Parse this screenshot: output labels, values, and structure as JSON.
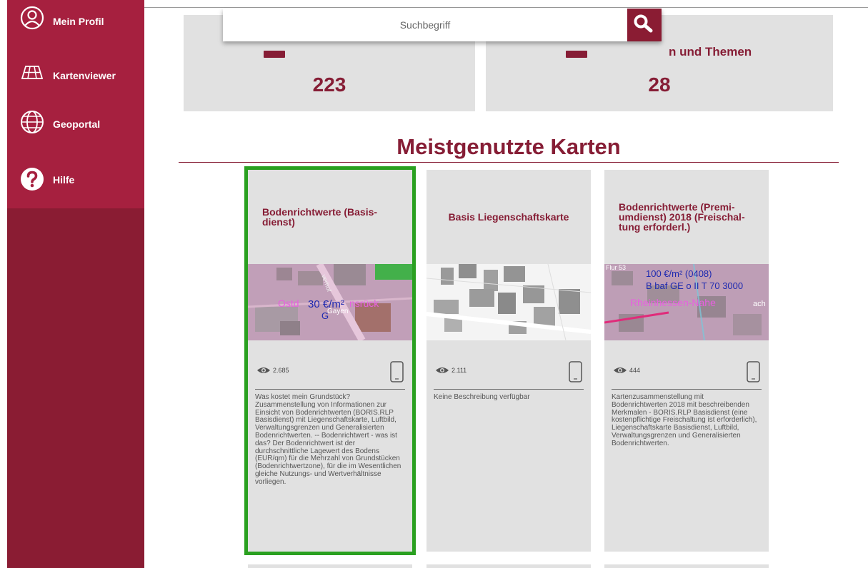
{
  "sidebar": {
    "items": [
      {
        "label": "Mein Profil",
        "icon": "user-circle-icon"
      },
      {
        "label": "Kartenviewer",
        "icon": "map-grid-icon"
      },
      {
        "label": "Geoportal",
        "icon": "globe-icon"
      },
      {
        "label": "Hilfe",
        "icon": "help-icon"
      }
    ]
  },
  "stats": [
    {
      "title": "",
      "value": "223"
    },
    {
      "title": "n und Themen",
      "value": "28"
    }
  ],
  "search": {
    "placeholder": "Suchbegriff",
    "button_icon": "search-icon"
  },
  "section": {
    "title": "Meistgenutzte Karten"
  },
  "cards": [
    {
      "title": "Bodenrichtwerte (Basis-dienst)",
      "views": "2.685",
      "description": "Was kostet mein Grundstück? Zusammenstellung von Informationen zur Einsicht von Bodenrichtwerten (BORIS.RLP Basisdienst) mit Liegenschaftskarte, Luftbild, Verwaltungsgrenzen und Generalisierten Bodenrichtwerten. -- Bodenrichtwert - was ist das? Der Bodenrichtwert ist der durchschnittliche Lagewert des Bodens (EUR/qm) für die Mehrzahl von Grundstücken (Bodenrichtwertzone), für die im Wesentlichen gleiche Nutzungs- und Wertverhältnisse vorliegen.",
      "map_labels": [
        "30 €/m²",
        "G",
        "Ostd",
        "nsrück",
        "Gayen",
        "verhof"
      ]
    },
    {
      "title": "Basis Liegenschaftskarte",
      "views": "2.111",
      "description": "Keine Beschreibung verfügbar",
      "map_labels": []
    },
    {
      "title": "Bodenrichtwerte (Premi-umdienst) 2018 (Freischal-tung erforderl.)",
      "views": "444",
      "description": "Kartenzusammenstellung mit Bodenrichtwerten 2018 mit beschreibenden Merkmalen - BORIS.RLP Basisdienst (eine kostenpflichtige Freischaltung ist erforderlich), Liegenschaftskarte Basisdienst, Luftbild, Verwaltungsgrenzen und Generalisierten Bodenrichtwerten.",
      "map_labels": [
        "100 €/m² (0408)",
        "B baf GE o II T 70 3000",
        "Rheinhessen-Nahe",
        "Flur 53",
        "ach"
      ]
    }
  ],
  "colors": {
    "brand": "#861d35",
    "sidebar_top": "#a6203f",
    "sidebar_bottom": "#8a1c33",
    "selected_outline": "#2aa020",
    "card_bg": "#e1e1e1"
  }
}
